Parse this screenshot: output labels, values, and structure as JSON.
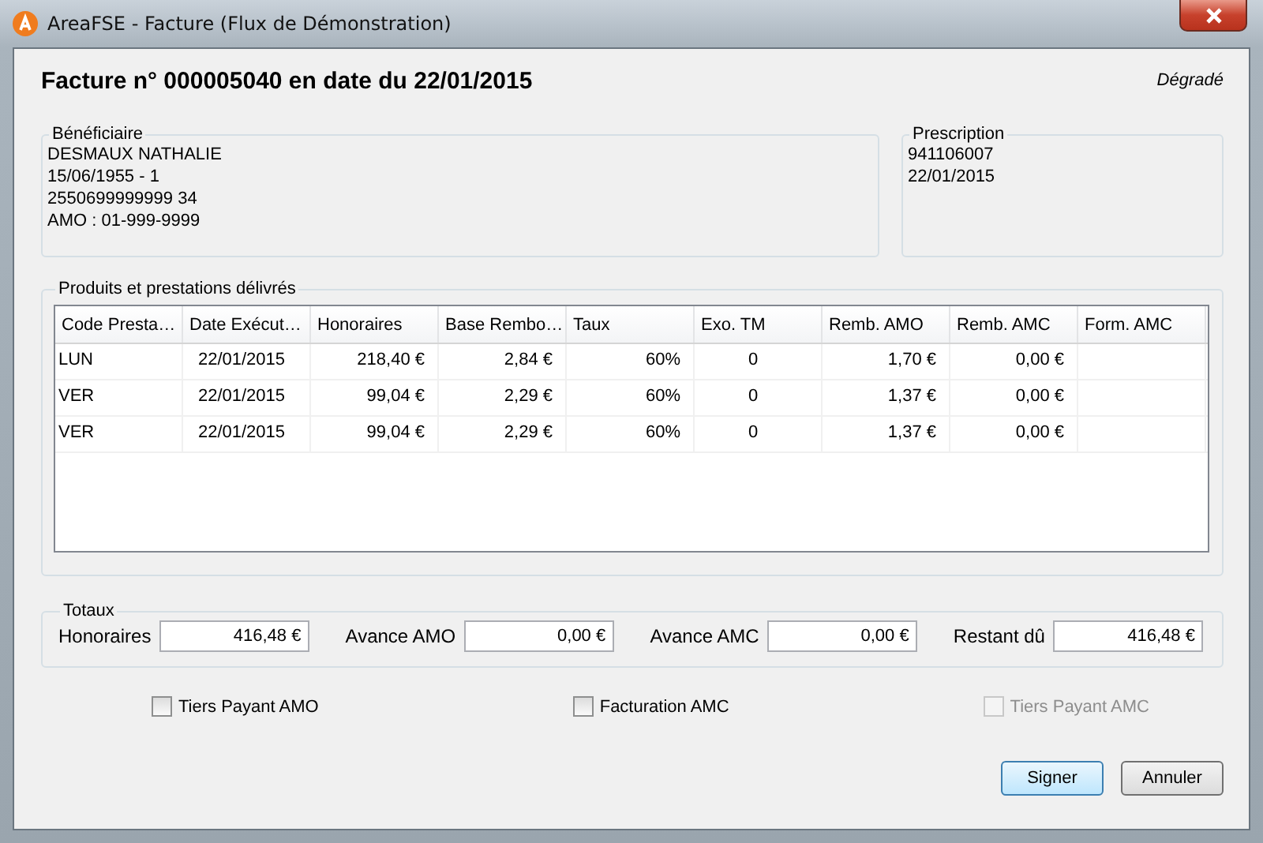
{
  "window": {
    "title": "AreaFSE - Facture (Flux de Démonstration)"
  },
  "heading": "Facture n° 000005040 en date du 22/01/2015",
  "mode": "Dégradé",
  "beneficiary": {
    "title": "Bénéficiaire",
    "lines": [
      "DESMAUX NATHALIE",
      "15/06/1955 - 1",
      "2550699999999 34",
      "AMO : 01-999-9999"
    ]
  },
  "prescription": {
    "title": "Prescription",
    "lines": [
      "941106007",
      "22/01/2015"
    ]
  },
  "products": {
    "title": "Produits et prestations délivrés",
    "columns": [
      "Code Presta…",
      "Date Exécut…",
      "Honoraires",
      "Base Rembo…",
      "Taux",
      "Exo. TM",
      "Remb. AMO",
      "Remb. AMC",
      "Form. AMC"
    ],
    "rows": [
      [
        "LUN",
        "22/01/2015",
        "218,40 €",
        "2,84 €",
        "60%",
        "0",
        "1,70 €",
        "0,00 €",
        ""
      ],
      [
        "VER",
        "22/01/2015",
        "99,04 €",
        "2,29 €",
        "60%",
        "0",
        "1,37 €",
        "0,00 €",
        ""
      ],
      [
        "VER",
        "22/01/2015",
        "99,04 €",
        "2,29 €",
        "60%",
        "0",
        "1,37 €",
        "0,00 €",
        ""
      ]
    ]
  },
  "totals": {
    "title": "Totaux",
    "fields": [
      {
        "label": "Honoraires",
        "value": "416,48 €"
      },
      {
        "label": "Avance AMO",
        "value": "0,00 €"
      },
      {
        "label": "Avance AMC",
        "value": "0,00 €"
      },
      {
        "label": "Restant dû",
        "value": "416,48 €"
      }
    ]
  },
  "checkboxes": [
    {
      "label": "Tiers Payant AMO",
      "checked": false,
      "disabled": false
    },
    {
      "label": "Facturation AMC",
      "checked": false,
      "disabled": false
    },
    {
      "label": "Tiers Payant AMC",
      "checked": false,
      "disabled": true
    }
  ],
  "buttons": [
    {
      "label": "Signer",
      "default": true
    },
    {
      "label": "Annuler",
      "default": false
    }
  ]
}
